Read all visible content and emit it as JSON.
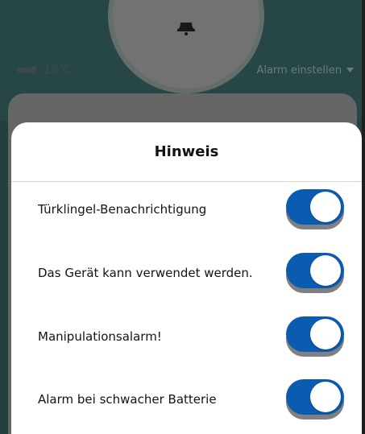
{
  "header": {
    "temperature": "18℃",
    "alarm_setting_label": "Alarm einstellen"
  },
  "dialog": {
    "title": "Hinweis",
    "items": [
      {
        "label": "Türklingel-Benachrichtigung",
        "enabled": true
      },
      {
        "label": "Das Gerät kann verwendet werden.",
        "enabled": true
      },
      {
        "label": "Manipulationsalarm!",
        "enabled": true
      },
      {
        "label": "Alarm bei schwacher Batterie",
        "enabled": true
      }
    ]
  },
  "colors": {
    "header_bg": "#2f5756",
    "toggle_on": "#0b5bb0",
    "dialog_bg": "#ffffff"
  },
  "icons": {
    "device": "bell-icon",
    "temperature": "thermometer-icon",
    "dropdown": "caret-down-icon"
  }
}
